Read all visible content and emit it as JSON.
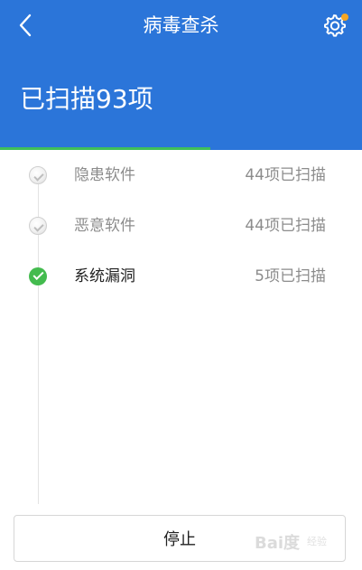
{
  "header": {
    "title": "病毒查杀",
    "scan_summary": "已扫描93项",
    "accent_color": "#2b75d9",
    "notification_dot_color": "#f5a623",
    "progress_fraction": 0.58,
    "progress_color": "#3fbf59",
    "icons": {
      "back": "chevron-left-icon",
      "settings": "gear-icon"
    }
  },
  "scan_items": [
    {
      "name": "隐患软件",
      "count": "44项已扫描",
      "status": "pending"
    },
    {
      "name": "恶意软件",
      "count": "44项已扫描",
      "status": "pending"
    },
    {
      "name": "系统漏洞",
      "count": "5项已扫描",
      "status": "done"
    }
  ],
  "status_colors": {
    "done": "#43bb4e",
    "pending": "#d9d9d9"
  },
  "stop_button": {
    "label": "停止"
  },
  "watermark": {
    "brand": "Bai度",
    "subtext": "经验"
  }
}
